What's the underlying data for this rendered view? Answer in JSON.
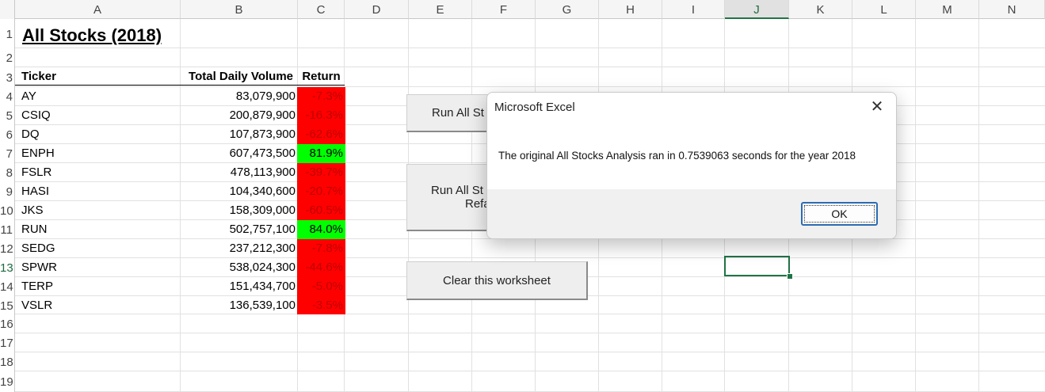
{
  "spreadsheet": {
    "columns": [
      "A",
      "B",
      "C",
      "D",
      "E",
      "F",
      "G",
      "H",
      "I",
      "J",
      "K",
      "L",
      "M",
      "N"
    ],
    "rows": [
      "1",
      "2",
      "3",
      "4",
      "5",
      "6",
      "7",
      "8",
      "9",
      "10",
      "11",
      "12",
      "13",
      "14",
      "15",
      "16",
      "17",
      "18",
      "19"
    ],
    "selected_column": "J",
    "selected_row": "13",
    "title": "All Stocks (2018)",
    "headers": {
      "ticker": "Ticker",
      "volume": "Total Daily Volume",
      "return": "Return"
    },
    "data": [
      {
        "ticker": "AY",
        "volume": "83,079,900",
        "return": "-7.3%",
        "color": "#ff0000"
      },
      {
        "ticker": "CSIQ",
        "volume": "200,879,900",
        "return": "-16.3%",
        "color": "#ff0000"
      },
      {
        "ticker": "DQ",
        "volume": "107,873,900",
        "return": "-62.6%",
        "color": "#ff0000"
      },
      {
        "ticker": "ENPH",
        "volume": "607,473,500",
        "return": "81.9%",
        "color": "#00ff00"
      },
      {
        "ticker": "FSLR",
        "volume": "478,113,900",
        "return": "-39.7%",
        "color": "#ff0000"
      },
      {
        "ticker": "HASI",
        "volume": "104,340,600",
        "return": "-20.7%",
        "color": "#ff0000"
      },
      {
        "ticker": "JKS",
        "volume": "158,309,000",
        "return": "-60.5%",
        "color": "#ff0000"
      },
      {
        "ticker": "RUN",
        "volume": "502,757,100",
        "return": "84.0%",
        "color": "#00ff00"
      },
      {
        "ticker": "SEDG",
        "volume": "237,212,300",
        "return": "-7.8%",
        "color": "#ff0000"
      },
      {
        "ticker": "SPWR",
        "volume": "538,024,300",
        "return": "-44.6%",
        "color": "#ff0000"
      },
      {
        "ticker": "TERP",
        "volume": "151,434,700",
        "return": "-5.0%",
        "color": "#ff0000"
      },
      {
        "ticker": "VSLR",
        "volume": "136,539,100",
        "return": "-3.5%",
        "color": "#ff0000"
      }
    ]
  },
  "buttons": {
    "run_all_line1": "Run All St",
    "run_refactored_line1": "Run All St",
    "run_refactored_line2": "Refa",
    "clear_label": "Clear this worksheet"
  },
  "dialog": {
    "title": "Microsoft Excel",
    "message": "The original All Stocks Analysis ran in 0.7539063 seconds for the year 2018",
    "ok_label": "OK",
    "close_icon": "close-icon"
  },
  "colors": {
    "positive": "#00ff00",
    "negative": "#ff0000",
    "selection": "#217346"
  }
}
